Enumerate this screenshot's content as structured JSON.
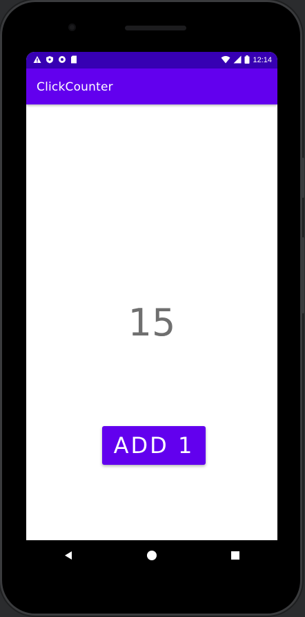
{
  "app": {
    "title": "ClickCounter",
    "count": "15",
    "button_label": "ADD 1"
  },
  "status_bar": {
    "time": "12:14",
    "left_icons": [
      "warning-icon",
      "shield-icon",
      "circle-icon",
      "sim-card-icon"
    ],
    "right_icons": [
      "wifi-icon",
      "signal-icon",
      "battery-icon"
    ]
  },
  "nav_bar": {
    "buttons": [
      "back-icon",
      "home-icon",
      "recents-icon"
    ]
  },
  "colors": {
    "primary": "#6200ee",
    "status_bar": "#3700b3",
    "count_text": "#6f6f6f"
  }
}
